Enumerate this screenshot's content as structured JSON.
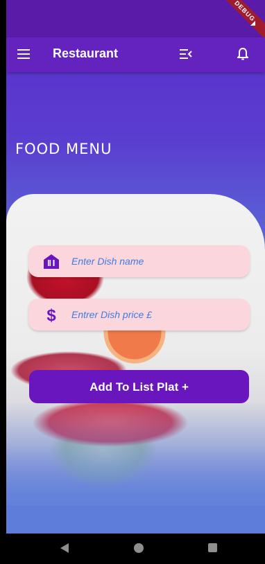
{
  "app_bar": {
    "title": "Restaurant",
    "icons": [
      "menu-icon",
      "sort-icon",
      "notifications-bell-icon"
    ]
  },
  "debug_banner": "DEBUG",
  "section_title": "FOOD MENU",
  "form": {
    "dish_name_placeholder": "Enter Dish name",
    "dish_price_placeholder": "Entrer Dish price £",
    "submit_label": "Add To List Plat +"
  },
  "nav_bar": [
    "back",
    "home",
    "recent-apps"
  ],
  "colors": {
    "primary": "#6a16bf",
    "app_bar": "#6423bf",
    "field_bg": "#fcd6dd",
    "placeholder": "#3f7be0"
  }
}
